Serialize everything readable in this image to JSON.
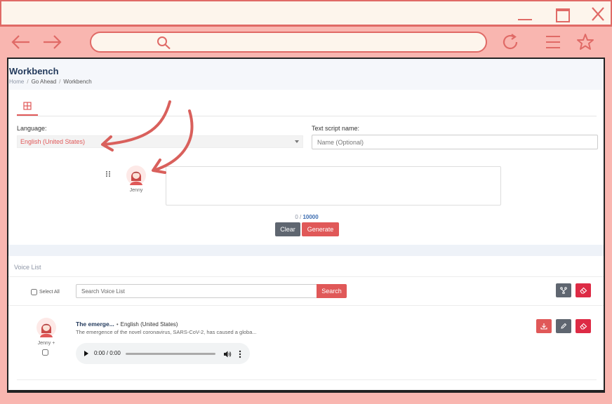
{
  "browser": {
    "url_value": "",
    "colors": {
      "accent": "#e06a66",
      "chrome_bg": "#fdf5ec",
      "frame_bg": "#f9b6b0"
    }
  },
  "page": {
    "title": "Workbench",
    "breadcrumb": [
      "Home",
      "Go Ahead",
      "Workbench"
    ]
  },
  "generator": {
    "language_label": "Language:",
    "language_value": "English (United States)",
    "script_name_label": "Text script name:",
    "script_name_placeholder": "Name (Optional)",
    "speaker_name": "Jenny",
    "script_text": "",
    "count_current": "0",
    "count_separator": " / ",
    "count_max": "10000",
    "clear_label": "Clear",
    "generate_label": "Generate"
  },
  "voice_list": {
    "title": "Voice List",
    "select_all_label": "Select All",
    "search_placeholder": "Search Voice List",
    "search_label": "Search",
    "items": [
      {
        "speaker": "Jenny +",
        "title": "The emerge...",
        "bullet": "•",
        "language": "English (United States)",
        "description": "The emergence of the novel coronavirus, SARS-CoV-2, has caused a globa...",
        "time": "0:00 / 0:00"
      }
    ]
  },
  "colors": {
    "primary": "#e05858",
    "secondary": "#5f6670",
    "danger": "#dd2b45",
    "heading": "#233a5c"
  }
}
